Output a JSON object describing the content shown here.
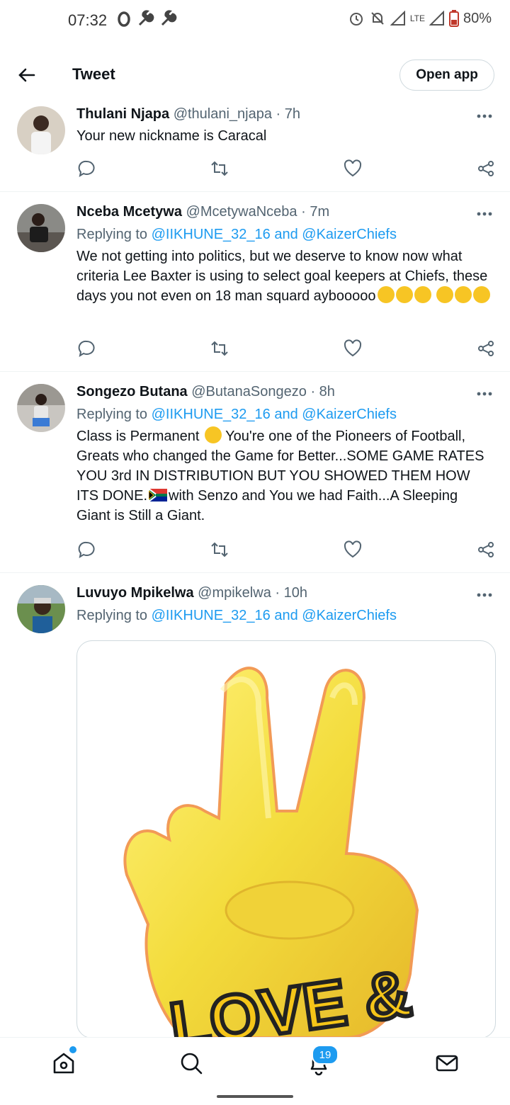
{
  "status_bar": {
    "time": "07:32",
    "battery": "80%",
    "network": "LTE",
    "icons": [
      "o-icon",
      "wrench-icon",
      "wrench-icon",
      "alarm-icon",
      "mute-icon",
      "signal-icon",
      "battery-icon"
    ]
  },
  "header": {
    "title": "Tweet",
    "open_app_label": "Open app"
  },
  "tweets": [
    {
      "name": "Thulani Njapa",
      "meta": "@thulani_njapa · 7h",
      "text": "Your new nickname is Caracal"
    },
    {
      "name": "Nceba Mcetywa",
      "meta": "@McetywaNceba · 7m",
      "reply_prefix": "Replying to",
      "reply_link": "@IIKHUNE_32_16 and @KaizerChiefs",
      "text": "We not getting into politics, but we deserve to know now what criteria Lee Baxter is using to select goal keepers at Chiefs, these days you not even on 18 man squard aybooooo",
      "emojis": [
        "thinking-face",
        "thinking-face",
        "thinking-face",
        "thinking-face",
        "crying-face",
        "crying-face"
      ]
    },
    {
      "name": "Songezo Butana",
      "meta": "@ButanaSongezo · 8h",
      "reply_prefix": "Replying to",
      "reply_link": "@IIKHUNE_32_16 and @KaizerChiefs",
      "text_a": "Class is Permanent",
      "text_b": " You're one of the Pioneers of Football, Greats who changed the Game for Better...SOME GAME RATES YOU 3rd IN DISTRIBUTION BUT YOU SHOWED THEM HOW ITS DONE.",
      "text_c": "with Senzo and You we had Faith...A Sleeping Giant is Still a Giant."
    },
    {
      "name": "Luvuyo Mpikelwa",
      "meta": "@mpikelwa · 10h",
      "reply_prefix": "Replying to",
      "reply_link": "@IIKHUNE_32_16 and @KaizerChiefs",
      "media_text": "LOVE &"
    }
  ],
  "tabbar": {
    "notifications_badge": "19",
    "icons": [
      "home-icon",
      "search-icon",
      "bell-icon",
      "mail-icon"
    ]
  },
  "colors": {
    "accent": "#1d9bf0",
    "text": "#0f1419",
    "muted": "#536471",
    "emoji_yellow": "#f7c524"
  }
}
